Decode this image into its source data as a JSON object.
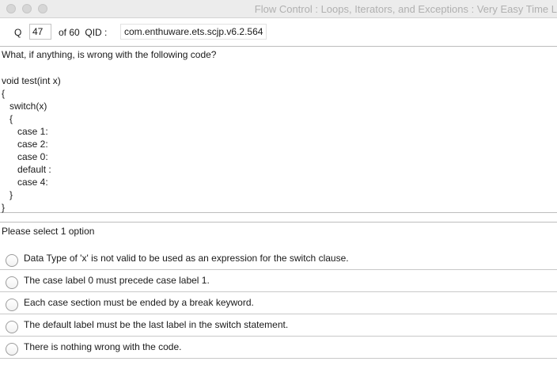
{
  "window": {
    "title": "Flow Control : Loops, Iterators, and Exceptions  :  Very Easy   Time L"
  },
  "header": {
    "q_label": "Q",
    "question_number": "47",
    "of_total": "of 60",
    "qid_label": "QID :",
    "qid_value": "com.enthuware.ets.scjp.v6.2.564"
  },
  "question": {
    "prompt": "What, if anything, is wrong with the following code?",
    "code_lines": [
      "void test(int x)",
      "{",
      "   switch(x)",
      "   {",
      "      case 1:",
      "      case 2:",
      "      case 0:",
      "      default :",
      "      case 4:",
      "   }",
      "}"
    ]
  },
  "options": {
    "instruction": "Please select 1 option",
    "items": [
      {
        "label": "Data Type of 'x' is not valid to be used as an expression for the switch clause.",
        "selected": false
      },
      {
        "label": "The case label 0 must precede case label 1.",
        "selected": false
      },
      {
        "label": "Each case section must be ended by a break keyword.",
        "selected": false
      },
      {
        "label": "The default label must be the last label in the switch statement.",
        "selected": false
      },
      {
        "label": "There is nothing wrong with the code.",
        "selected": false
      }
    ]
  }
}
